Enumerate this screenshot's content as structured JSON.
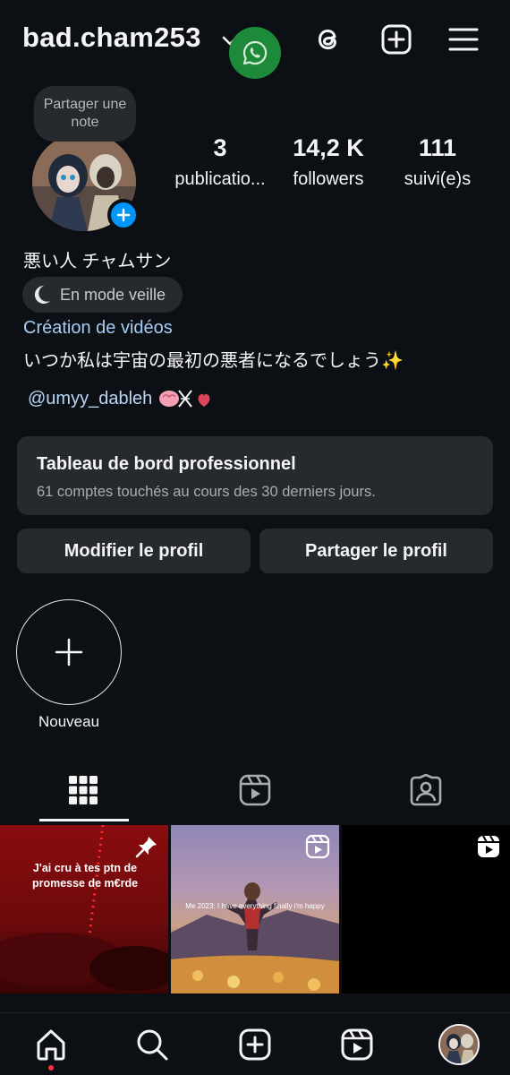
{
  "header": {
    "username": "bad.cham253",
    "icons": [
      "chevron-down-icon",
      "whatsapp-icon",
      "threads-icon",
      "create-icon",
      "menu-icon"
    ]
  },
  "profile": {
    "note_text": "Partager une note",
    "stats": [
      {
        "value": "3",
        "label": "publicatio..."
      },
      {
        "value": "14,2 K",
        "label": "followers"
      },
      {
        "value": "111",
        "label": "suivi(e)s"
      }
    ],
    "display_name": "悪い人 チャムサン",
    "status": "En mode veille",
    "category": "Création de vidéos",
    "bio": "いつか私は宇宙の最初の悪者になるでしょう✨",
    "mention": "@umyy_dableh"
  },
  "dashboard": {
    "title": "Tableau de bord professionnel",
    "subtitle": "61 comptes touchés au cours des 30 derniers jours."
  },
  "buttons": {
    "edit": "Modifier le profil",
    "share": "Partager le profil"
  },
  "highlights": {
    "new_label": "Nouveau"
  },
  "posts": [
    {
      "caption": "J'ai cru à tes ptn de promesse de m€rde",
      "badge": "pin-icon"
    },
    {
      "caption": "Me 2023: I have everything finally i'm happy",
      "badge": "reels-icon"
    },
    {
      "caption": "",
      "badge": "reels-icon"
    }
  ],
  "colors": {
    "background": "#0c1014",
    "surface": "#262a2f",
    "link": "#a6cdf4",
    "accent_blue": "#0095f6",
    "whatsapp_green": "#1d8a3a"
  }
}
